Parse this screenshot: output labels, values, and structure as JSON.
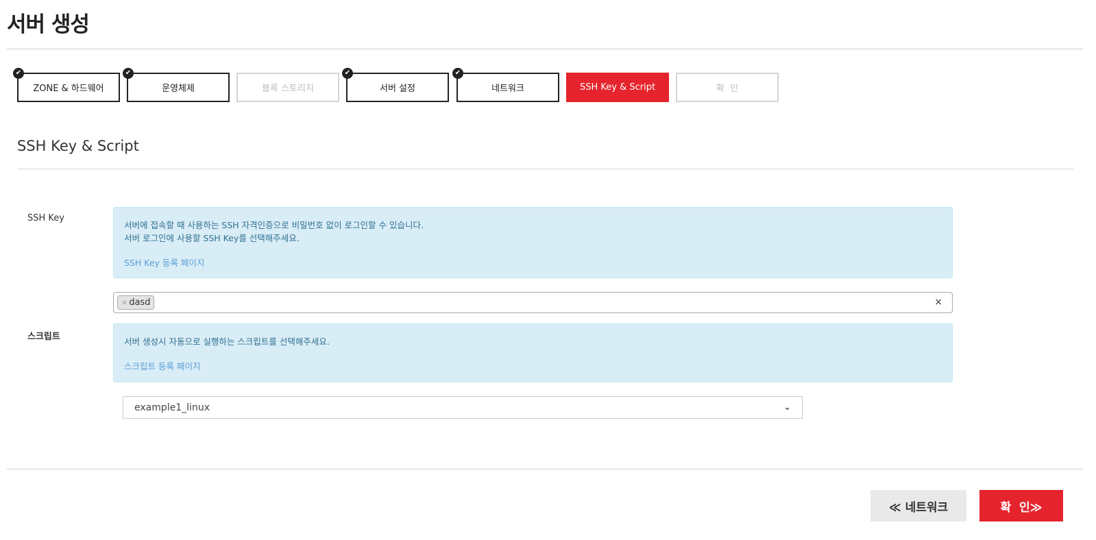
{
  "page": {
    "title": "서버 생성"
  },
  "steps": [
    {
      "label": "ZONE & 하드웨어",
      "state": "done"
    },
    {
      "label": "운영체제",
      "state": "done"
    },
    {
      "label": "블록 스토리지",
      "state": "disabled"
    },
    {
      "label": "서버 설정",
      "state": "done"
    },
    {
      "label": "네트워크",
      "state": "done"
    },
    {
      "label": "SSH Key & Script",
      "state": "active"
    },
    {
      "label": "확  인",
      "state": "disabled"
    }
  ],
  "check_icon": "✔",
  "section": {
    "title": "SSH Key & Script"
  },
  "ssh_key": {
    "label": "SSH Key",
    "info_line1": "서버에 접속할 때 사용하는 SSH 자격인증으로 비밀번호 없이 로그인할 수 있습니다.",
    "info_line2": "서버 로그인에 사용할 SSH Key를 선택해주세요.",
    "link": "SSH Key 등록 페이지",
    "selected_tag": "dasd",
    "tag_remove": "×",
    "clear": "×"
  },
  "script": {
    "label": "스크립트",
    "info_line1": "서버 생성시 자동으로 실행하는 스크립트를 선택해주세요.",
    "link": "스크립트 등록 페이지",
    "selected": "example1_linux",
    "chevron": "⌄"
  },
  "buttons": {
    "prev": "≪ 네트워크",
    "next": "확  인≫"
  },
  "colors": {
    "accent": "#e5242d",
    "info_bg": "#d9edf7",
    "info_text": "#31708f",
    "link": "#5b9ed6"
  }
}
